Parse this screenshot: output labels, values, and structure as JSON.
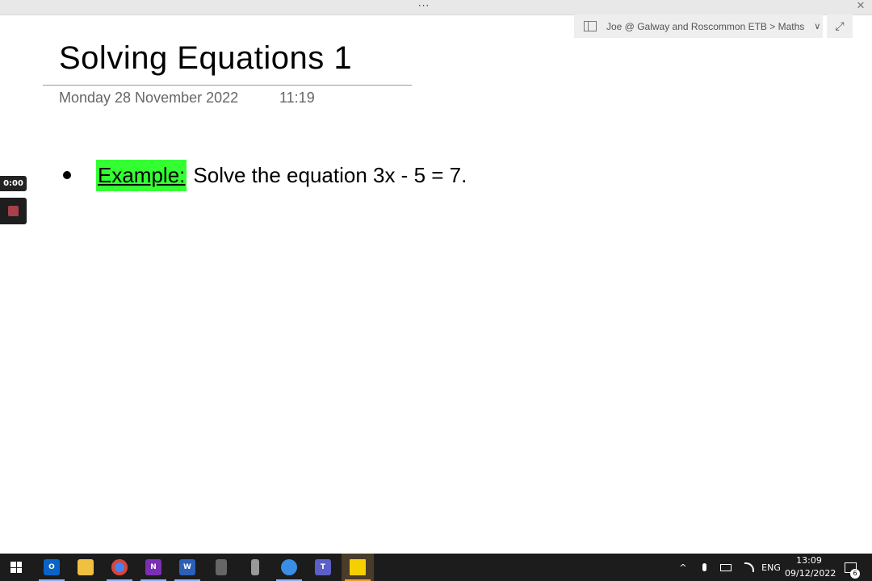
{
  "window": {
    "menu_dots": "···",
    "close_glyph": "✕"
  },
  "notebook": {
    "breadcrumb": "Joe @ Galway and Roscommon ETB > Maths",
    "chevron_glyph": "∨",
    "expand_glyph": "⤢"
  },
  "page": {
    "title": "Solving Equations 1",
    "date": "Monday 28 November 2022",
    "time": "11:19",
    "content": {
      "highlight_label": "Example:",
      "text": "Solve the equation 3x - 5 = 7."
    }
  },
  "recorder": {
    "elapsed": "0:00"
  },
  "taskbar": {
    "apps": [
      {
        "name": "start",
        "label": ""
      },
      {
        "name": "outlook",
        "label": "O",
        "color": "#0a64c8"
      },
      {
        "name": "file-explorer",
        "label": "",
        "color": "#f0c040"
      },
      {
        "name": "chrome",
        "label": "",
        "color": "#4285f4"
      },
      {
        "name": "onenote",
        "label": "N",
        "color": "#7b2fb5"
      },
      {
        "name": "word",
        "label": "W",
        "color": "#2b5fb8"
      },
      {
        "name": "calculator",
        "label": "",
        "color": "#666666"
      },
      {
        "name": "phone-link",
        "label": "",
        "color": "#999999"
      },
      {
        "name": "edge-remote",
        "label": "",
        "color": "#3a8ee6"
      },
      {
        "name": "teams",
        "label": "T",
        "color": "#5b5fc7"
      },
      {
        "name": "sticky-notes",
        "label": "",
        "color": "#f5d000"
      }
    ],
    "tray": {
      "chevron_glyph": "^",
      "language": "ENG"
    },
    "clock": {
      "time": "13:09",
      "date": "09/12/2022"
    },
    "notifications_count": "6"
  }
}
